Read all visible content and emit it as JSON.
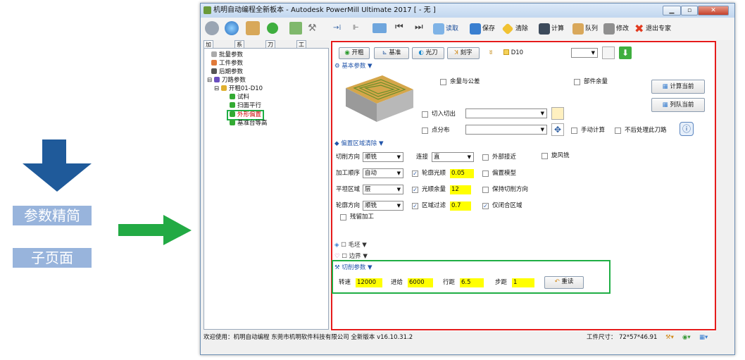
{
  "side": {
    "label1": "参数精简",
    "label2": "子页面"
  },
  "window": {
    "title": "机明自动编程全新板本 - Autodesk PowerMill Ultimate 2017   [ - 无 ]"
  },
  "toolbar": {
    "load": "读取",
    "save": "保存",
    "clear": "清除",
    "compute": "计算",
    "queue": "队列",
    "modify": "修改",
    "exit": "退出专家"
  },
  "left_tabs": [
    "加工参数",
    "系统设置",
    "刀路模板",
    "工具箱"
  ],
  "tree": [
    "批量参数",
    "工件参数",
    "后期参数",
    "刀路参数",
    "开粗01-D10",
    "试料",
    "扫面平行",
    "外形偏置",
    "基准台等高"
  ],
  "top_buttons": {
    "open": "开粗",
    "datum": "基准",
    "finish": "光刀",
    "engrave": "刻字",
    "tool": "D10"
  },
  "basic": {
    "header": "基本参数",
    "stock_tol": "余量与公差",
    "part_stock": "部件余量",
    "calc_current": "计算当前",
    "queue_current": "列队当前",
    "lead_inout": "切入切出",
    "point_dist": "点分布",
    "manual_calc": "手动计算",
    "no_post": "不后处理此刀路"
  },
  "offset": {
    "header": "偏置区域清除",
    "cut_dir_label": "切削方向",
    "cut_dir": "顺铣",
    "connect_label": "连接",
    "connect": "直",
    "ext_approach": "外部接近",
    "vortex": "旋风铣",
    "order_label": "加工顺序",
    "order": "自动",
    "profile_smooth": "轮廓光顺",
    "profile_smooth_val": "0.05",
    "offset_model": "偏置模型",
    "flat_label": "平坦区域",
    "flat": "层",
    "smooth_stock": "光顺余量",
    "smooth_stock_val": "12",
    "keep_dir": "保持切削方向",
    "contour_dir_label": "轮廓方向",
    "contour_dir": "顺铣",
    "area_filter": "区域过滤",
    "area_filter_val": "0.7",
    "closed_only": "仅闭合区域",
    "rest": "残留加工"
  },
  "blank": "毛坯",
  "boundary": "边界",
  "cutting": {
    "header": "切削参数",
    "speed_label": "转速",
    "speed": "12000",
    "feed_label": "进给",
    "feed": "6000",
    "stepover_label": "行距",
    "stepover": "6.5",
    "stepdown_label": "步距",
    "stepdown": "1",
    "reset": "重读"
  },
  "status": {
    "left": "欢迎使用：机明自动编程 东莞市机明软件科技有限公司 全新版本 v16.10.31.2",
    "size_label": "工件尺寸：",
    "size": "72*57*46.91"
  }
}
